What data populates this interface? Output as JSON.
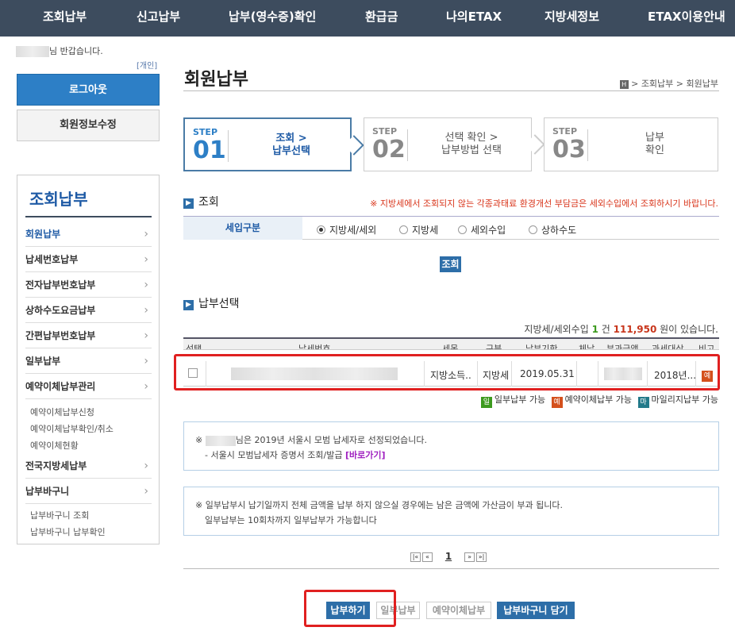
{
  "topnav": {
    "items": [
      "조회납부",
      "신고납부",
      "납부(영수증)확인",
      "환급금",
      "나의ETAX",
      "지방세정보",
      "ETAX이용안내"
    ]
  },
  "sidebar": {
    "greeting_suffix": "님 반갑습니다.",
    "personal_tag": "[개인]",
    "logout_label": "로그아웃",
    "member_edit_label": "회원정보수정",
    "menu_title": "조회납부",
    "items": [
      {
        "label": "회원납부",
        "active": true
      },
      {
        "label": "납세번호납부"
      },
      {
        "label": "전자납부번호납부"
      },
      {
        "label": "상하수도요금납부"
      },
      {
        "label": "간편납부번호납부"
      },
      {
        "label": "일부납부"
      },
      {
        "label": "예약이체납부관리"
      },
      {
        "label": "전국지방세납부"
      },
      {
        "label": "납부바구니"
      }
    ],
    "reservation_subs": [
      "예약이체납부신청",
      "예약이체납부확인/취소",
      "예약이체현황"
    ],
    "basket_subs": [
      "납부바구니 조회",
      "납부바구니 납부확인"
    ]
  },
  "page": {
    "title": "회원납부",
    "breadcrumb": [
      "조회납부",
      "회원납부"
    ],
    "home_icon": "home-icon"
  },
  "steps": [
    {
      "label": "STEP",
      "num": "01",
      "line1": "조회 >",
      "line2": "납부선택",
      "active": true
    },
    {
      "label": "STEP",
      "num": "02",
      "line1": "선택 확인 >",
      "line2": "납부방법 선택",
      "active": false
    },
    {
      "label": "STEP",
      "num": "03",
      "line1": "납부",
      "line2": "확인",
      "active": false
    }
  ],
  "search_section": {
    "heading": "조회",
    "notice": "※ 지방세에서 조회되지 않는 각종과태료 환경개선 부담금은 세외수입에서 조회하시기 바랍니다.",
    "filter_label": "세입구분",
    "options": [
      "지방세/세외",
      "지방세",
      "세외수입",
      "상하수도"
    ],
    "selected": "지방세/세외",
    "search_button": "조회"
  },
  "payment_section": {
    "heading": "납부선택",
    "summary_prefix": "지방세/세외수입",
    "count": "1",
    "count_unit": "건",
    "amount": "111,950",
    "summary_suffix": "원이 있습니다."
  },
  "table": {
    "headers": [
      "선택",
      "납세번호",
      "세목",
      "구분",
      "납부기한",
      "체납",
      "부과금액",
      "과세대상",
      "비고"
    ],
    "rows": [
      {
        "tax_item": "지방소득..",
        "category": "지방세",
        "due_date": "2019.05.31",
        "target": "2018년...",
        "note_badge": "예"
      }
    ]
  },
  "legend": [
    {
      "badge": "일",
      "text": "일부납부 가능",
      "color": "#3c9a1e"
    },
    {
      "badge": "예",
      "text": "예약이체납부 가능",
      "color": "#d4501c"
    },
    {
      "badge": "마",
      "text": "마일리지납부 가능",
      "color": "#237a8a"
    }
  ],
  "info_box1": {
    "line1_prefix": "※",
    "line1": "님은 2019년 서울시 모범 납세자로 선정되었습니다.",
    "line2": "- 서울시 모범납세자 증명서 조회/발급",
    "link": "[바로가기]"
  },
  "info_box2": {
    "line1": "※ 일부납부시 납기일까지 전체 금액을 납부 하지 않으실 경우에는 남은 금액에 가산금이 부과 됩니다.",
    "line2": "일부납부는 10회차까지 일부납부가 가능합니다"
  },
  "pager": {
    "first": "|«",
    "prev": "«",
    "current": "1",
    "next": "»",
    "last": "»|"
  },
  "actions": {
    "pay": "납부하기",
    "partial": "일부납부",
    "reserve": "예약이체납부",
    "basket": "납부바구니 담기"
  }
}
